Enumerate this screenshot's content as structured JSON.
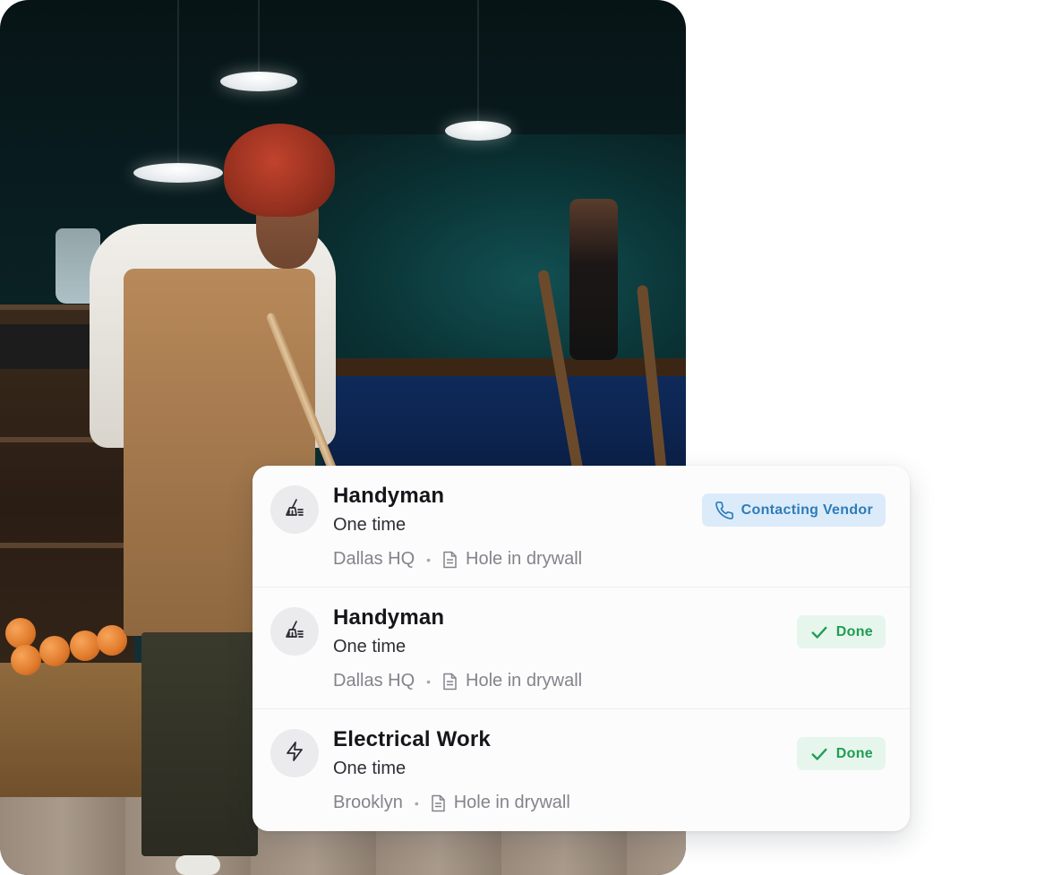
{
  "background_color": "#ffffff",
  "photo": {
    "icon": "cafe-worker-sweeping-photo"
  },
  "work_orders": [
    {
      "title": "Handyman",
      "frequency": "One time",
      "location": "Dallas HQ",
      "note": "Hole in drywall",
      "icon": "broom-icon",
      "status": "Contacting Vendor",
      "status_kind": "info",
      "status_icon": "phone-icon"
    },
    {
      "title": "Handyman",
      "frequency": "One time",
      "location": "Dallas HQ",
      "note": "Hole in drywall",
      "icon": "broom-icon",
      "status": "Done",
      "status_kind": "success",
      "status_icon": "check-icon"
    },
    {
      "title": "Electrical Work",
      "frequency": "One time",
      "location": "Brooklyn",
      "note": "Hole in drywall",
      "icon": "lightning-icon",
      "status": "Done",
      "status_kind": "success",
      "status_icon": "check-icon"
    }
  ],
  "colors": {
    "info_badge_bg": "#dcebfa",
    "info_badge_text": "#2d7cb9",
    "success_badge_bg": "#e6f6ec",
    "success_badge_text": "#1f9d53"
  }
}
